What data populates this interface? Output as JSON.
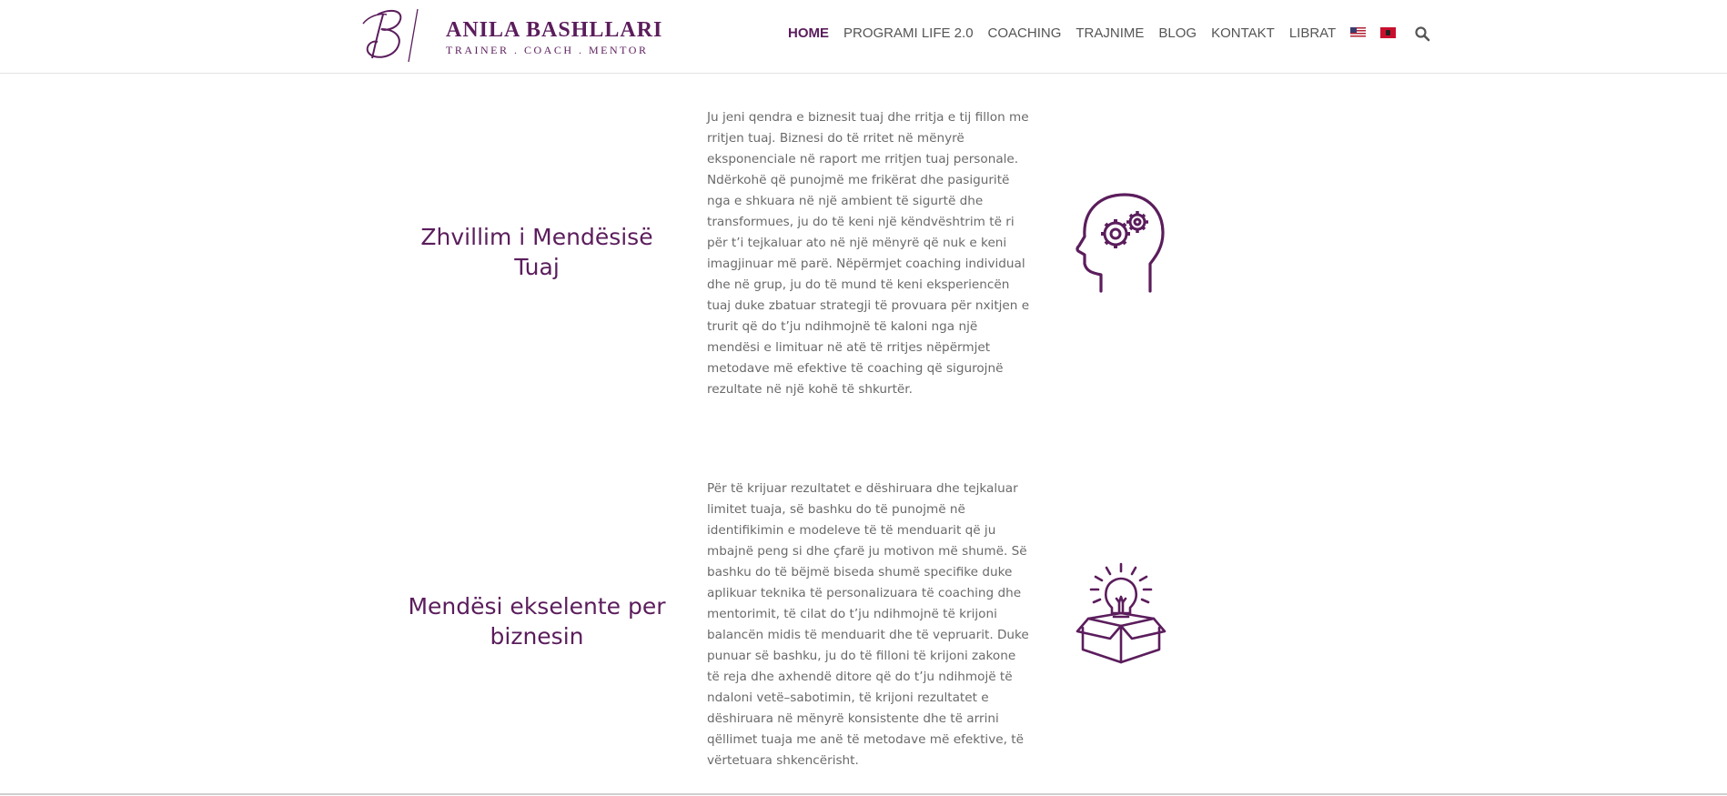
{
  "brand": {
    "name": "ANILA BASHLLARI",
    "tagline": "TRAINER . COACH . MENTOR"
  },
  "nav": {
    "items": [
      {
        "label": "HOME",
        "active": true
      },
      {
        "label": "PROGRAMI LIFE 2.0",
        "active": false
      },
      {
        "label": "COACHING",
        "active": false
      },
      {
        "label": "TRAJNIME",
        "active": false
      },
      {
        "label": "BLOG",
        "active": false
      },
      {
        "label": "KONTAKT",
        "active": false
      },
      {
        "label": "LIBRAT",
        "active": false
      }
    ],
    "languages": [
      "english-flag-icon",
      "albanian-flag-icon"
    ],
    "search_icon": "search-icon"
  },
  "sections": [
    {
      "title_line1": "Zhvillim i Mendësisë",
      "title_line2": "Tuaj",
      "text": "Ju jeni qendra e biznesit tuaj dhe rritja e tij fillon me rritjen tuaj. Biznesi do të rritet në mënyrë eksponenciale në raport me rritjen tuaj personale. Ndërkohë që punojmë me frikërat dhe pasiguritë nga e shkuara në një ambient të sigurtë dhe transformues, ju do të keni një këndvështrim të ri për t’i tejkaluar ato në një mënyrë që nuk e keni imagjinuar më parë. Nëpërmjet coaching individual dhe në grup, ju do të mund të keni eksperiencën tuaj duke zbatuar strategji të provuara për nxitjen e trurit që do t’ju ndihmojnë të kaloni nga një mendësi e limituar në atë të rritjes nëpërmjet metodave më efektive të coaching që sigurojnë rezultate në një kohë të shkurtër.",
      "icon": "head-gears-icon"
    },
    {
      "title_line1": "Mendësi ekselente per",
      "title_line2": "biznesin",
      "text": "Për të krijuar rezultatet e dëshiruara dhe tejkaluar limitet tuaja, së bashku do të punojmë në identifikimin e modeleve të të menduarit që ju mbajnë peng si dhe çfarë ju motivon më shumë. Së bashku do të bëjmë biseda shumë specifike duke aplikuar teknika të personalizuara të coaching dhe mentorimit, të cilat do t’ju ndihmojnë të krijoni balancën midis të menduarit dhe të vepruarit. Duke punuar së bashku, ju do të filloni të krijoni zakone të reja dhe axhendë ditore që do t’ju ndihmojë të ndaloni vetë–sabotimin, të krijoni rezultatet e dëshiruara në mënyrë konsistente dhe të arrini qëllimet tuaja me anë të metodave më efektive, të vërtetuara shkencërisht.",
      "icon": "lightbulb-box-icon"
    }
  ],
  "colors": {
    "accent": "#5b1d5c",
    "text": "#6a6a6a",
    "nav_text": "#555555"
  }
}
